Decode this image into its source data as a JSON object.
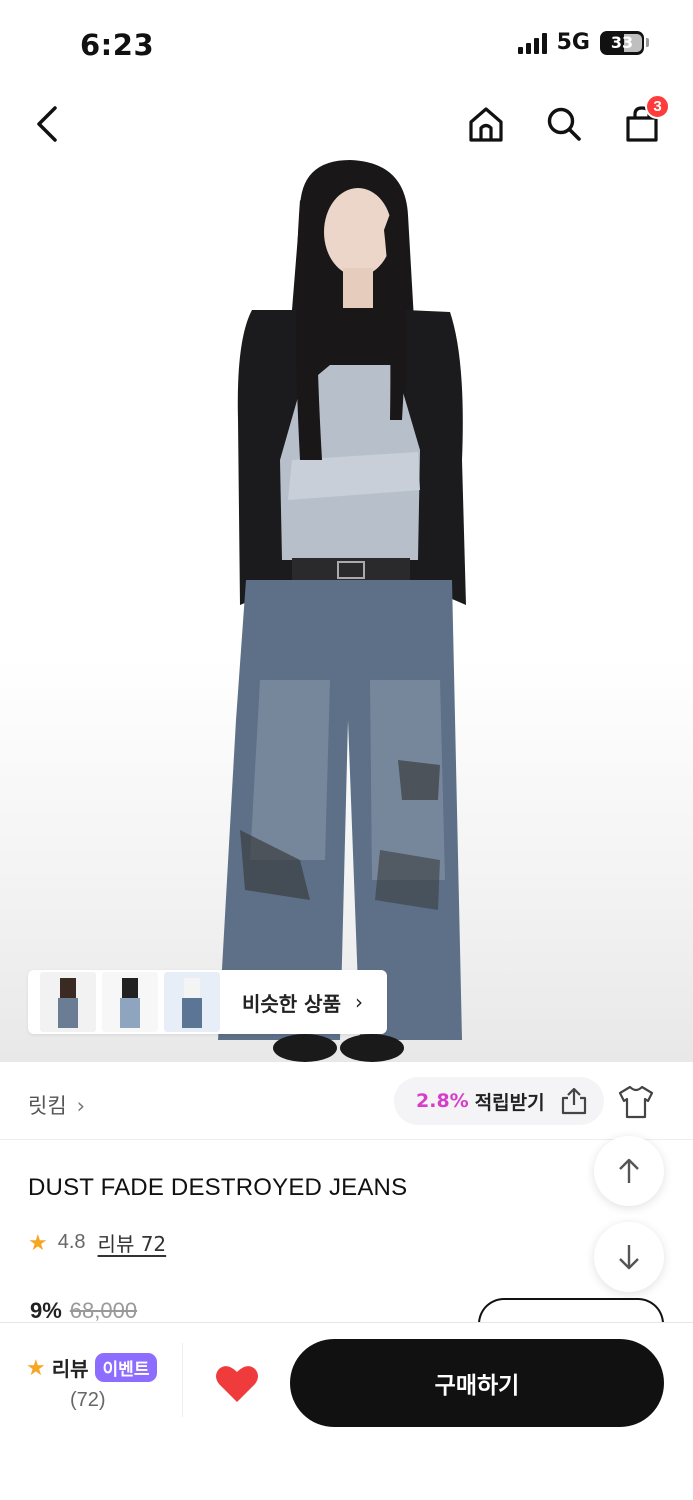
{
  "status_bar": {
    "time": "6:23",
    "network": "5G",
    "battery": "33"
  },
  "nav": {
    "cart_count": "3"
  },
  "similar": {
    "label": "비슷한 상품",
    "chevron": "›"
  },
  "brand": {
    "name": "릿킴",
    "chevron": "›"
  },
  "points": {
    "rate": "2.8%",
    "label": "적립받기"
  },
  "product": {
    "title": "DUST FADE DESTROYED JEANS",
    "rating": "4.8",
    "review_link": "리뷰 72",
    "discount": "9%",
    "original_price": "68,000"
  },
  "bottom_bar": {
    "review_label": "리뷰",
    "event_badge": "이벤트",
    "review_count": "(72)",
    "buy_label": "구매하기"
  },
  "icons": {
    "star": "★",
    "heart_color": "#ef3b3b",
    "points_accent": "#d63ec9",
    "event_badge_color": "#8c6dff"
  }
}
